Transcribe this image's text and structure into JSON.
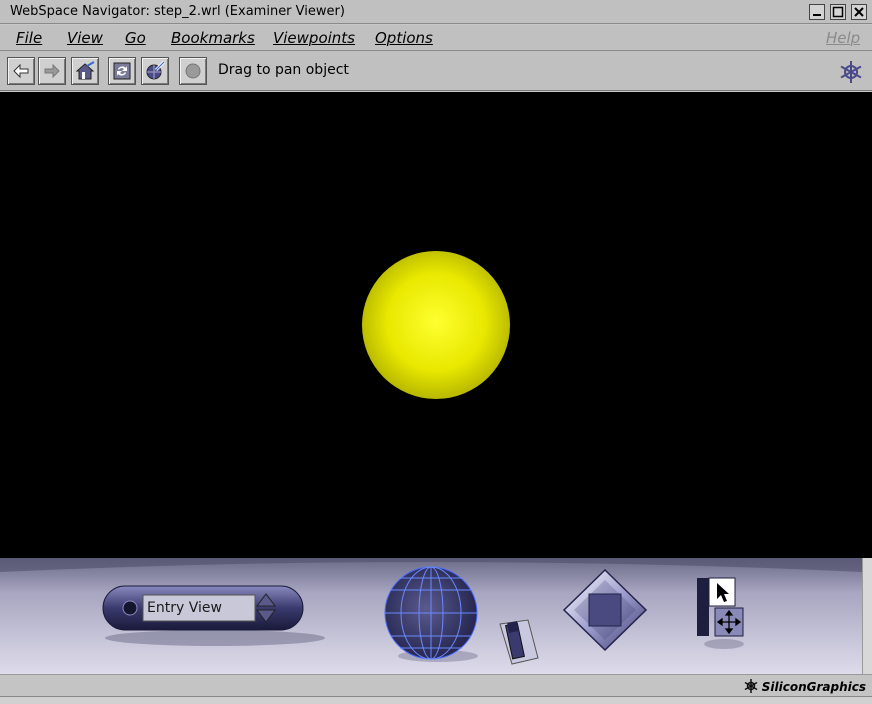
{
  "window": {
    "title": "WebSpace Navigator: step_2.wrl (Examiner Viewer)",
    "controls": [
      "minimize",
      "maximize",
      "close"
    ]
  },
  "menu": {
    "items": [
      {
        "label": "File"
      },
      {
        "label": "View"
      },
      {
        "label": "Go"
      },
      {
        "label": "Bookmarks"
      },
      {
        "label": "Viewpoints"
      },
      {
        "label": "Options"
      }
    ],
    "help": "Help"
  },
  "toolbar": {
    "buttons": [
      {
        "name": "back-button",
        "icon": "arrow-left-icon"
      },
      {
        "name": "forward-button",
        "icon": "arrow-right-icon"
      },
      {
        "name": "home-button",
        "icon": "home-icon"
      },
      {
        "name": "reload-button",
        "icon": "reload-icon"
      },
      {
        "name": "seek-button",
        "icon": "globe-pencil-icon"
      },
      {
        "name": "stop-button",
        "icon": "stop-icon"
      }
    ],
    "status": "Drag to pan object"
  },
  "viewport": {
    "background": "#000000",
    "object": {
      "type": "sphere",
      "color": "#f0f000"
    }
  },
  "dashboard": {
    "viewpoint_selector": {
      "value": "Entry View"
    },
    "brand": "SiliconGraphics"
  },
  "colors": {
    "chrome": "#c0c0c0",
    "dashboard_top": "#7a7a9a",
    "dashboard_bottom": "#d8d6e6",
    "widget": "#3a3a6e",
    "sphere": "#f0f000"
  }
}
